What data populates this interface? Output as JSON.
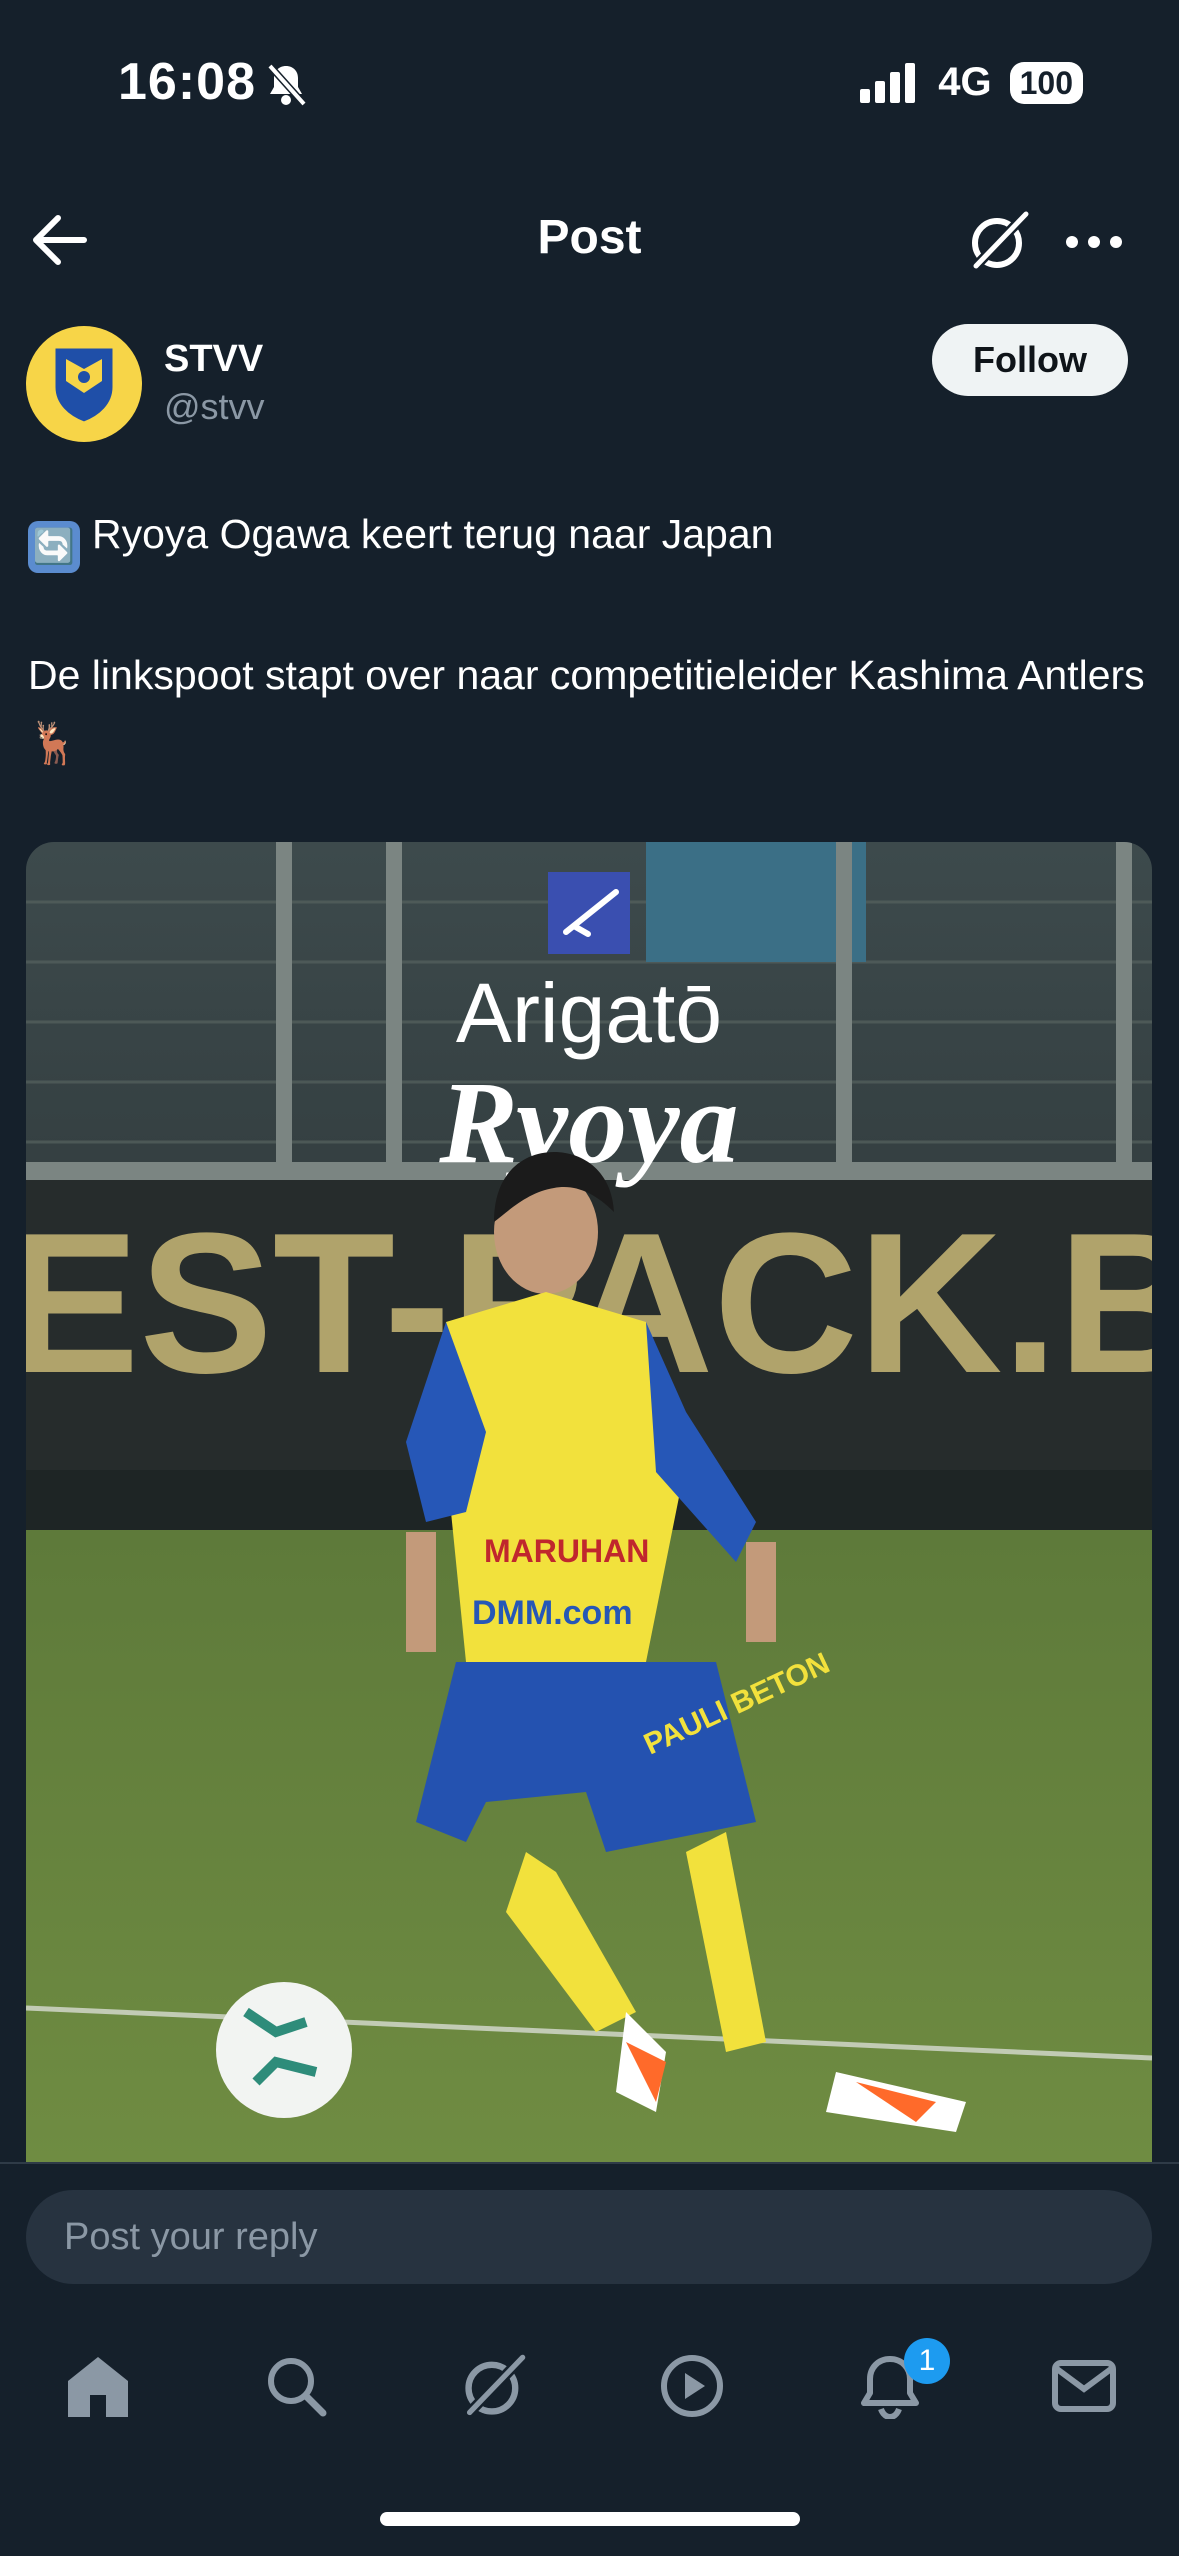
{
  "status_bar": {
    "time": "16:08",
    "network": "4G",
    "battery": "100",
    "icons": [
      "bell-slash-icon",
      "signal-icon",
      "battery-icon"
    ]
  },
  "header": {
    "title": "Post",
    "icons": [
      "back-arrow-icon",
      "grok-icon",
      "more-icon"
    ]
  },
  "post": {
    "author_name": "STVV",
    "handle": "@stvv",
    "follow_label": "Follow",
    "line1_emoji": "🔄",
    "line1": "Ryoya Ogawa keert terug naar Japan",
    "line2": "De linkspoot stapt over naar competitieleider Kashima Antlers 🦌",
    "media": {
      "heading1": "Arigatō",
      "heading2": "Ryoya",
      "banner_text": "EST-PACK.BE",
      "jersey_sponsor": "MARUHAN",
      "jersey_sponsor2": "DMM.com",
      "shorts_sponsor": "PAULI BETON"
    }
  },
  "reply": {
    "placeholder": "Post your reply"
  },
  "tab_bar": {
    "items": [
      "home-icon",
      "search-icon",
      "grok-icon",
      "video-icon",
      "notifications-icon",
      "messages-icon"
    ],
    "notification_count": "1"
  },
  "colors": {
    "background": "#15202b",
    "accent": "#1d9bf0",
    "stvv_yellow": "#f7d548",
    "stvv_blue": "#1f4fa8"
  }
}
